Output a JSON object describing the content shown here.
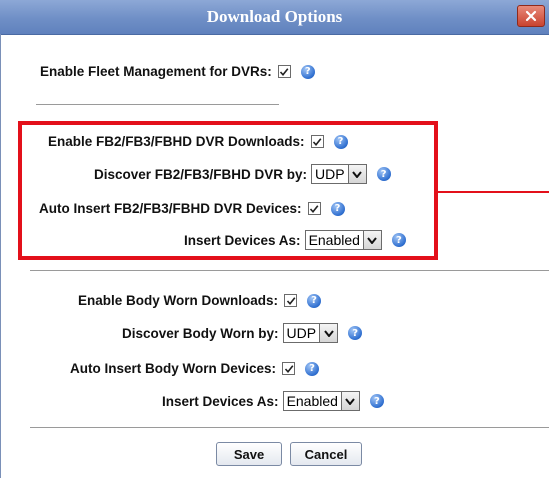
{
  "dialog": {
    "title": "Download Options",
    "close_icon": "close-x-icon"
  },
  "fleet": {
    "enable_label": "Enable Fleet Management for DVRs:",
    "enable_checked": true
  },
  "fb": {
    "enable_label": "Enable FB2/FB3/FBHD DVR Downloads:",
    "enable_checked": true,
    "discover_label": "Discover FB2/FB3/FBHD DVR by:",
    "discover_value": "UDP",
    "auto_insert_label": "Auto Insert FB2/FB3/FBHD DVR Devices:",
    "auto_insert_checked": true,
    "insert_as_label": "Insert Devices As:",
    "insert_as_value": "Enabled"
  },
  "body_worn": {
    "enable_label": "Enable Body Worn Downloads:",
    "enable_checked": true,
    "discover_label": "Discover Body Worn by:",
    "discover_value": "UDP",
    "auto_insert_label": "Auto Insert Body Worn Devices:",
    "auto_insert_checked": true,
    "insert_as_label": "Insert Devices As:",
    "insert_as_value": "Enabled"
  },
  "buttons": {
    "save": "Save",
    "cancel": "Cancel"
  },
  "help_glyph": "?",
  "colors": {
    "title_bar": "#6f8fc6",
    "highlight": "#e3101a",
    "help_icon": "#2f6fd0"
  }
}
